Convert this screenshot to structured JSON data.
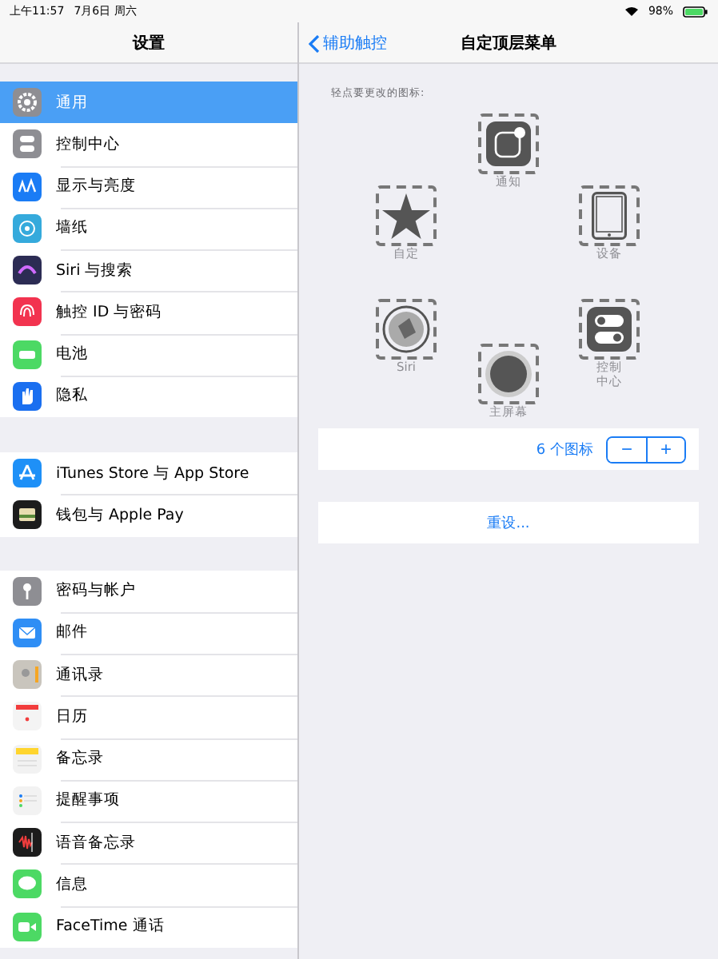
{
  "status_bar": {
    "time": "上午11:57",
    "date": "7月6日 周六",
    "battery": "98%"
  },
  "sidebar": {
    "title": "设置",
    "groups": [
      {
        "items": [
          {
            "label": "通用",
            "color": "#8e8e93",
            "selected": true
          },
          {
            "label": "控制中心",
            "color": "#8e8e93",
            "selected": false
          },
          {
            "label": "显示与亮度",
            "color": "#1a7cf5",
            "selected": false
          },
          {
            "label": "墙纸",
            "color": "#35aadc",
            "selected": false
          },
          {
            "label": "Siri 与搜索",
            "color": "#2c2c54",
            "selected": false
          },
          {
            "label": "触控 ID 与密码",
            "color": "#f2334f",
            "selected": false
          },
          {
            "label": "电池",
            "color": "#4cd964",
            "selected": false
          },
          {
            "label": "隐私",
            "color": "#1a6ff0",
            "selected": false
          }
        ]
      },
      {
        "items": [
          {
            "label": "iTunes Store 与 App Store",
            "color": "#1e90f7",
            "selected": false
          },
          {
            "label": "钱包与 Apple Pay",
            "color": "#1c1c1c",
            "selected": false
          }
        ]
      },
      {
        "items": [
          {
            "label": "密码与帐户",
            "color": "#8e8e93",
            "selected": false
          },
          {
            "label": "邮件",
            "color": "#2f8ef5",
            "selected": false
          },
          {
            "label": "通讯录",
            "color": "#c9c5bd",
            "selected": false
          },
          {
            "label": "日历",
            "color": "#f4f4f4",
            "selected": false
          },
          {
            "label": "备忘录",
            "color": "#f2f2f2",
            "selected": false
          },
          {
            "label": "提醒事项",
            "color": "#f2f2f2",
            "selected": false
          },
          {
            "label": "语音备忘录",
            "color": "#1c1c1c",
            "selected": false
          },
          {
            "label": "信息",
            "color": "#4cd964",
            "selected": false
          },
          {
            "label": "FaceTime 通话",
            "color": "#4cd964",
            "selected": false
          }
        ]
      }
    ]
  },
  "detail": {
    "back": "辅助触控",
    "title": "自定顶层菜单",
    "hint": "轻点要更改的图标:",
    "menu_icons": [
      {
        "label": "通知",
        "kind": "notification"
      },
      {
        "label": "自定",
        "kind": "star"
      },
      {
        "label": "设备",
        "kind": "device"
      },
      {
        "label": "Siri",
        "kind": "siri"
      },
      {
        "label": "控制中心",
        "kind": "control"
      },
      {
        "label": "主屏幕",
        "kind": "home"
      }
    ],
    "count_label": "6 个图标",
    "minus": "−",
    "plus": "+",
    "reset": "重设..."
  }
}
